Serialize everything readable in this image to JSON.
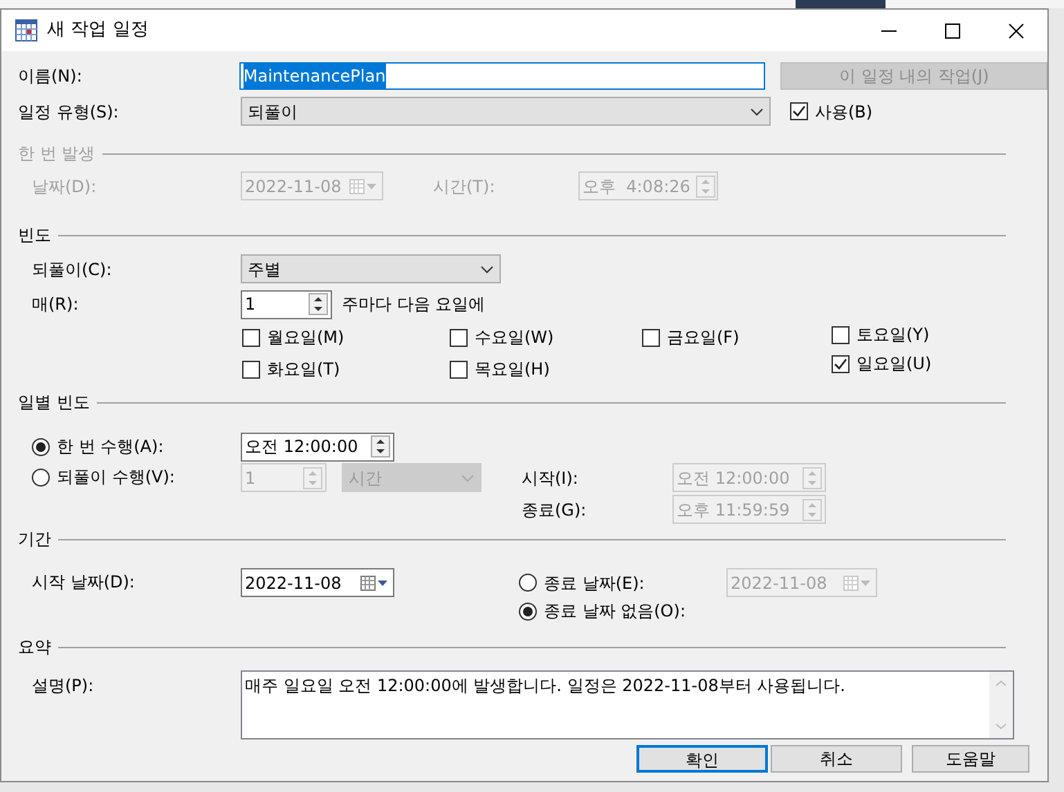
{
  "window": {
    "title": "새 작업 일정"
  },
  "name": {
    "label": "이름(N):",
    "value": "MaintenancePlan"
  },
  "jobs_button": {
    "label": "이 일정 내의 작업(J)",
    "disabled": true
  },
  "schedule_type": {
    "label": "일정 유형(S):",
    "value": "되풀이"
  },
  "enabled": {
    "label": "사용(B)",
    "checked": true
  },
  "one_time": {
    "title": "한 번 발생",
    "disabled": true,
    "date_label": "날짜(D):",
    "date": "2022-11-08",
    "time_label": "시간(T):",
    "time": "오후  4:08:26"
  },
  "frequency": {
    "title": "빈도",
    "occurs_label": "되풀이(C):",
    "occurs": "주별",
    "recurs_label": "매(R):",
    "recurs": "1",
    "recurs_suffix": "주마다 다음 요일에",
    "day_columns": [
      [
        {
          "label": "월요일(M)",
          "checked": false
        },
        {
          "label": "화요일(T)",
          "checked": false
        }
      ],
      [
        {
          "label": "수요일(W)",
          "checked": false
        },
        {
          "label": "목요일(H)",
          "checked": false
        }
      ],
      [
        {
          "label": "금요일(F)",
          "checked": false
        }
      ],
      [
        {
          "label": "토요일(Y)",
          "checked": false
        },
        {
          "label": "일요일(U)",
          "checked": true
        }
      ]
    ]
  },
  "daily": {
    "title": "일별 빈도",
    "options": [
      {
        "label": "한 번 수행(A):",
        "selected": true
      },
      {
        "label": "되풀이 수행(V):",
        "selected": false
      }
    ],
    "once_time": "오전 12:00:00",
    "every": "1",
    "every_unit": "시간",
    "start_label": "시작(I):",
    "start": "오전 12:00:00",
    "end_label": "종료(G):",
    "end": "오후 11:59:59"
  },
  "duration": {
    "title": "기간",
    "start_label": "시작 날짜(D):",
    "start": "2022-11-08",
    "end_options": [
      {
        "label": "종료 날짜(E):",
        "selected": false
      },
      {
        "label": "종료 날짜 없음(O):",
        "selected": true
      }
    ],
    "end_date": "2022-11-08"
  },
  "summary": {
    "title": "요약",
    "label": "설명(P):",
    "text": "매주 일요일 오전 12:00:00에 발생합니다. 일정은 2022-11-08부터 사용됩니다."
  },
  "buttons": [
    {
      "label": "확인",
      "default": true
    },
    {
      "label": "취소",
      "default": false
    },
    {
      "label": "도움말",
      "default": false
    }
  ]
}
